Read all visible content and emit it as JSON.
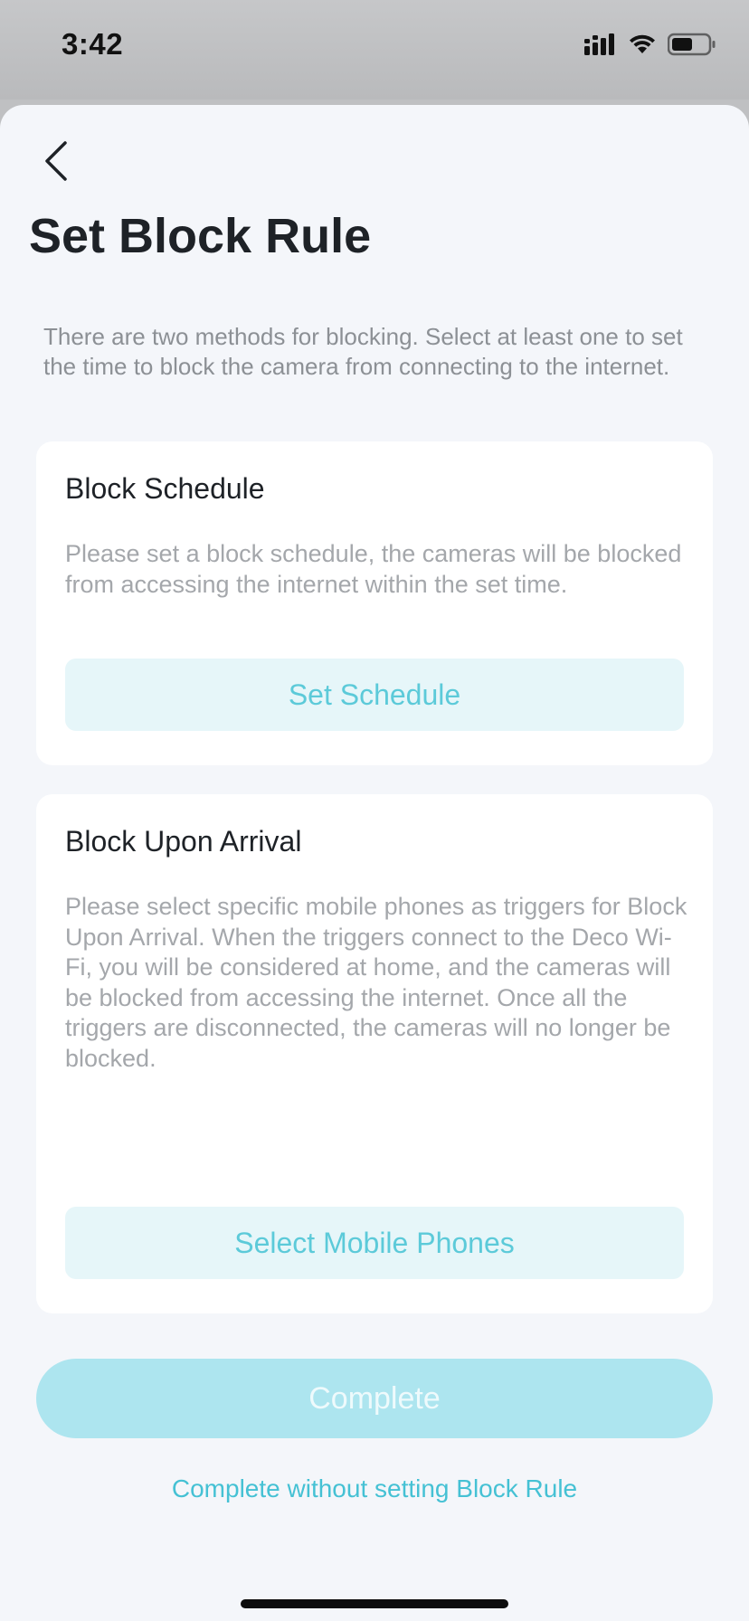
{
  "status_bar": {
    "time": "3:42",
    "icons": [
      "cellular-signal-icon",
      "wifi-icon",
      "battery-icon"
    ]
  },
  "header": {
    "back_icon": "chevron-left-icon",
    "title": "Set Block Rule"
  },
  "intro": "There are two methods for blocking. Select at least one to set the time to block the camera from connecting to the internet.",
  "schedule_card": {
    "title": "Block Schedule",
    "description": "Please set a block schedule, the cameras will be blocked from accessing the internet within the set time.",
    "button_label": "Set Schedule"
  },
  "arrival_card": {
    "title": "Block Upon Arrival",
    "description": "Please select specific mobile phones as triggers for Block Upon Arrival. When the triggers connect to the Deco Wi-Fi, you will be considered at home, and the cameras will be blocked from accessing the internet. Once all the triggers are disconnected, the cameras will no longer be blocked.",
    "button_label": "Select Mobile Phones"
  },
  "footer": {
    "complete_label": "Complete",
    "skip_label": "Complete without setting Block Rule"
  },
  "colors": {
    "accent": "#45c1d4",
    "accent_light": "#e6f6f9",
    "complete_disabled": "#ade5ef",
    "sheet_background": "#f4f6fa"
  }
}
